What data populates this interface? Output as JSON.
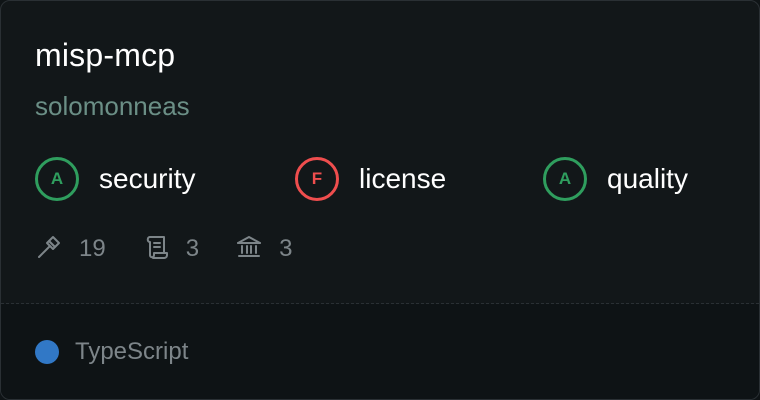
{
  "repo": {
    "name": "misp-mcp",
    "owner": "solomonneas"
  },
  "scores": [
    {
      "grade": "A",
      "label": "security",
      "status": "good"
    },
    {
      "grade": "F",
      "label": "license",
      "status": "bad"
    },
    {
      "grade": "A",
      "label": "quality",
      "status": "good"
    }
  ],
  "stats": {
    "tools": "19",
    "prompts": "3",
    "resources": "3"
  },
  "language": {
    "name": "TypeScript",
    "color": "#3178c6"
  },
  "colors": {
    "good": "#2f9e5e",
    "bad": "#ef4e4e",
    "owner": "#6b8f86",
    "muted": "#7d8589"
  }
}
